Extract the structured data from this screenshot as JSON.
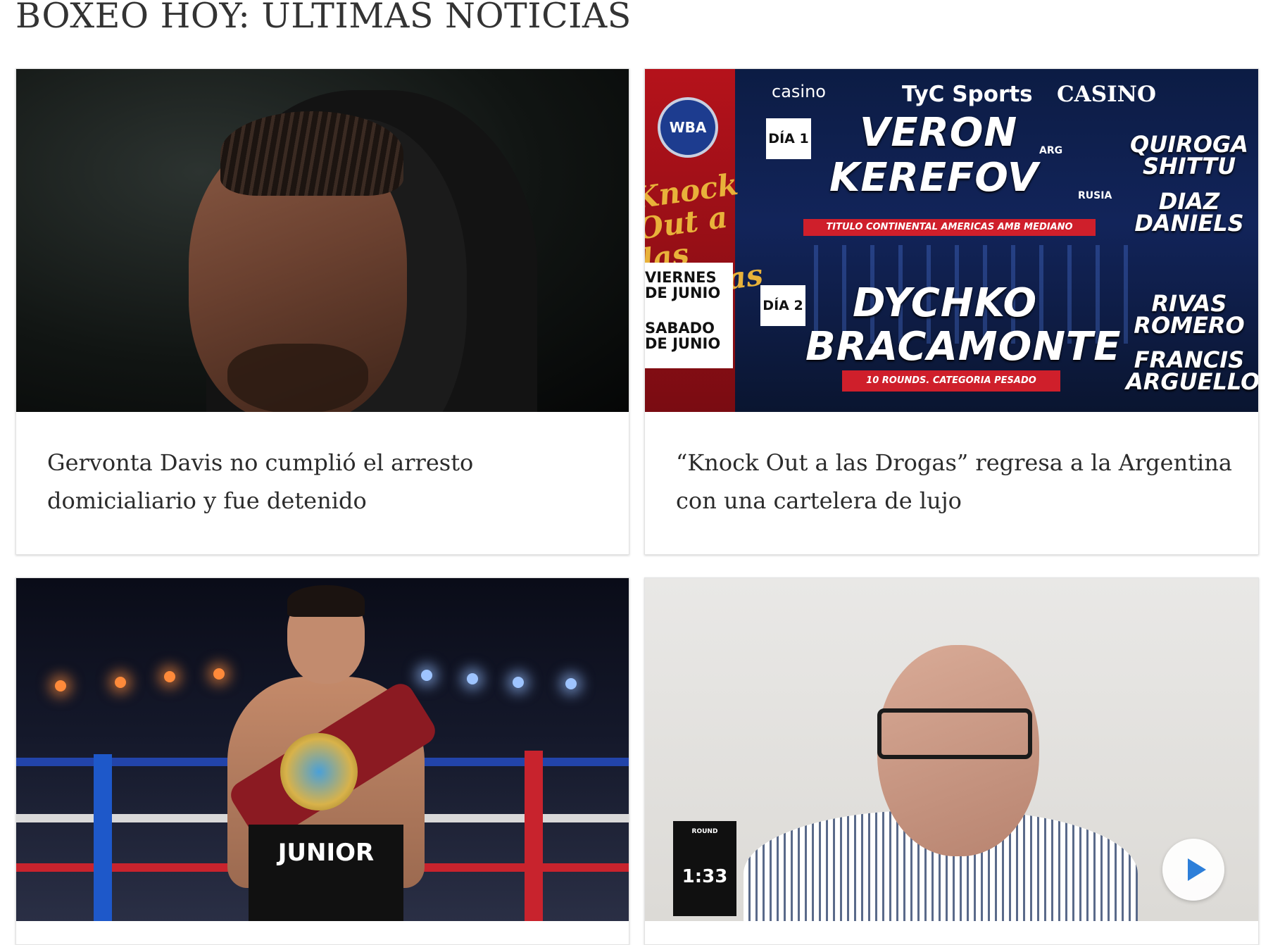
{
  "section": {
    "title": "BOXEO HOY: ÚLTIMAS NOTICIAS"
  },
  "cards": [
    {
      "headline": "Gervonta Davis no cumplió el arresto domicialiario y fue detenido"
    },
    {
      "headline": "“Knock Out a las Drogas” regresa a la Argentina con una cartelera de lujo",
      "poster": {
        "sponsors": [
          "casino",
          "TyC Sports",
          "CASINO"
        ],
        "wba": "WBA",
        "event": "Knock Out a las Drogas",
        "dates": [
          "VIERNES",
          "DE JUNIO",
          "SABADO",
          "DE JUNIO"
        ],
        "day1": "DÍA 1",
        "day2": "DÍA 2",
        "main1_a": "VERON",
        "main1_a_country": "ARG",
        "main1_b": "KEREFOV",
        "main1_b_country": "RUSIA",
        "main1_strip": "TITULO CONTINENTAL AMERICAS AMB MEDIANO",
        "main2_a": "DYCHKO",
        "main2_b": "BRACAMONTE",
        "main2_strip": "10 ROUNDS. CATEGORIA PESADO",
        "side": [
          "QUIROGA",
          "SHITTU",
          "DIAZ",
          "DANIELS",
          "RIVAS",
          "ROMERO",
          "FRANCIS",
          "ARGUELLO"
        ]
      }
    },
    {
      "photo": {
        "shorts_text": "JUNIOR"
      }
    },
    {
      "video": {
        "logo_text": "ROUND",
        "duration": "1:33"
      }
    }
  ]
}
